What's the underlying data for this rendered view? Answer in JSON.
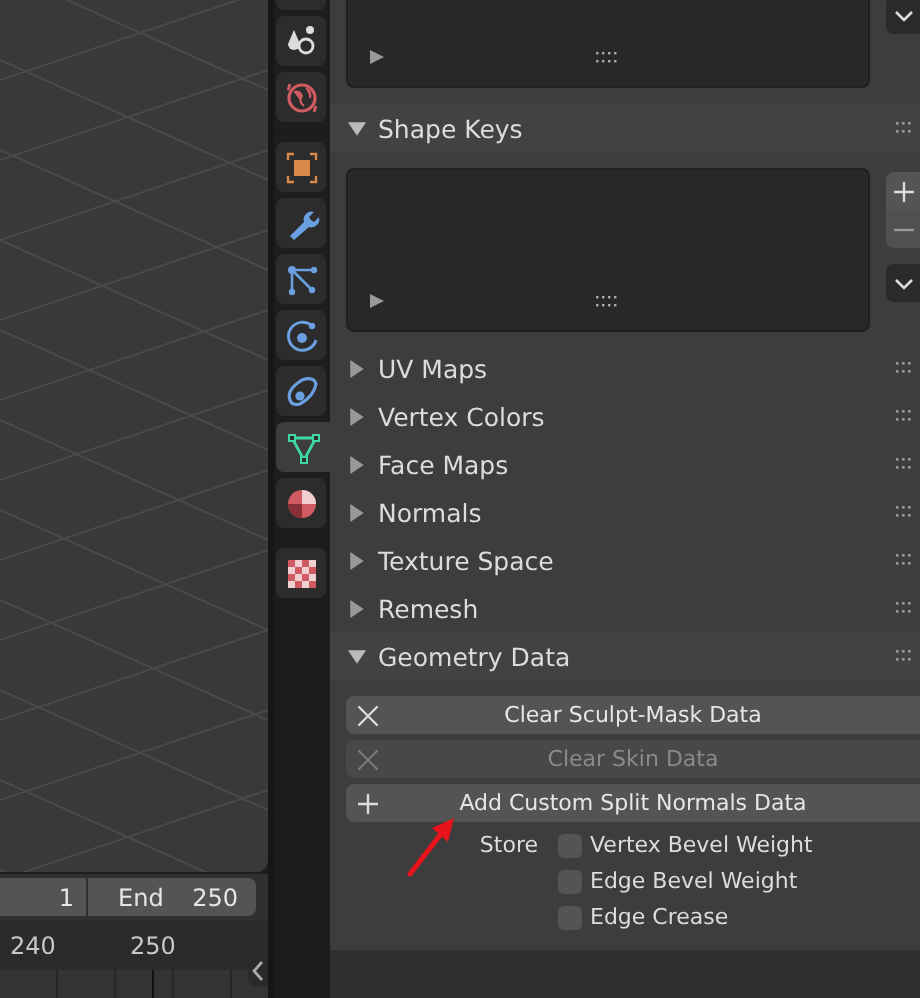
{
  "viewport": {
    "timeline": {
      "start_value": "1",
      "end_label": "End",
      "end_value": "250"
    },
    "ruler": [
      "240",
      "250"
    ]
  },
  "tab_groups": [
    [
      {
        "kind": "scene",
        "selected": false
      },
      {
        "kind": "world",
        "selected": false
      }
    ],
    [
      {
        "kind": "object",
        "selected": false
      },
      {
        "kind": "modifiers",
        "selected": false
      },
      {
        "kind": "particles",
        "selected": false
      },
      {
        "kind": "physics",
        "selected": false
      },
      {
        "kind": "constraints",
        "selected": false
      },
      {
        "kind": "data",
        "selected": true
      },
      {
        "kind": "material",
        "selected": false
      }
    ],
    [
      {
        "kind": "texture",
        "selected": false
      }
    ]
  ],
  "properties": {
    "panels": [
      {
        "title": "Shape Keys",
        "expanded": true,
        "kind": "list"
      },
      {
        "title": "UV Maps",
        "expanded": false
      },
      {
        "title": "Vertex Colors",
        "expanded": false
      },
      {
        "title": "Face Maps",
        "expanded": false
      },
      {
        "title": "Normals",
        "expanded": false
      },
      {
        "title": "Texture Space",
        "expanded": false
      },
      {
        "title": "Remesh",
        "expanded": false
      },
      {
        "title": "Geometry Data",
        "expanded": true,
        "kind": "geometry",
        "buttons": [
          {
            "label": "Clear Sculpt-Mask Data",
            "kind": "clear",
            "disabled": false
          },
          {
            "label": "Clear Skin Data",
            "kind": "clear",
            "disabled": true
          },
          {
            "label": "Add Custom Split Normals Data",
            "kind": "add",
            "disabled": false
          }
        ],
        "store_label": "Store",
        "checkboxes": [
          {
            "label": "Vertex Bevel Weight",
            "checked": false
          },
          {
            "label": "Edge Bevel Weight",
            "checked": false
          },
          {
            "label": "Edge Crease",
            "checked": false
          }
        ]
      }
    ]
  },
  "annotation": {
    "kind": "arrow",
    "color": "#e8141c"
  }
}
